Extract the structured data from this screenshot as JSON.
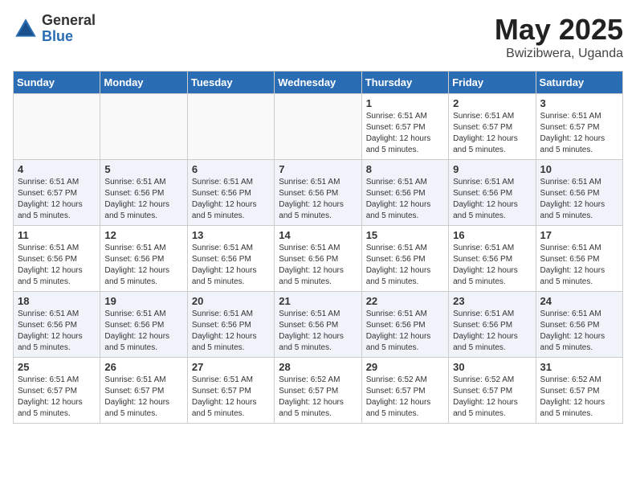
{
  "logo": {
    "general": "General",
    "blue": "Blue"
  },
  "header": {
    "month": "May 2025",
    "location": "Bwizibwera, Uganda"
  },
  "weekdays": [
    "Sunday",
    "Monday",
    "Tuesday",
    "Wednesday",
    "Thursday",
    "Friday",
    "Saturday"
  ],
  "weeks": [
    [
      {
        "day": null,
        "info": null
      },
      {
        "day": null,
        "info": null
      },
      {
        "day": null,
        "info": null
      },
      {
        "day": null,
        "info": null
      },
      {
        "day": "1",
        "info": "Sunrise: 6:51 AM\nSunset: 6:57 PM\nDaylight: 12 hours and 5 minutes."
      },
      {
        "day": "2",
        "info": "Sunrise: 6:51 AM\nSunset: 6:57 PM\nDaylight: 12 hours and 5 minutes."
      },
      {
        "day": "3",
        "info": "Sunrise: 6:51 AM\nSunset: 6:57 PM\nDaylight: 12 hours and 5 minutes."
      }
    ],
    [
      {
        "day": "4",
        "info": "Sunrise: 6:51 AM\nSunset: 6:57 PM\nDaylight: 12 hours and 5 minutes."
      },
      {
        "day": "5",
        "info": "Sunrise: 6:51 AM\nSunset: 6:56 PM\nDaylight: 12 hours and 5 minutes."
      },
      {
        "day": "6",
        "info": "Sunrise: 6:51 AM\nSunset: 6:56 PM\nDaylight: 12 hours and 5 minutes."
      },
      {
        "day": "7",
        "info": "Sunrise: 6:51 AM\nSunset: 6:56 PM\nDaylight: 12 hours and 5 minutes."
      },
      {
        "day": "8",
        "info": "Sunrise: 6:51 AM\nSunset: 6:56 PM\nDaylight: 12 hours and 5 minutes."
      },
      {
        "day": "9",
        "info": "Sunrise: 6:51 AM\nSunset: 6:56 PM\nDaylight: 12 hours and 5 minutes."
      },
      {
        "day": "10",
        "info": "Sunrise: 6:51 AM\nSunset: 6:56 PM\nDaylight: 12 hours and 5 minutes."
      }
    ],
    [
      {
        "day": "11",
        "info": "Sunrise: 6:51 AM\nSunset: 6:56 PM\nDaylight: 12 hours and 5 minutes."
      },
      {
        "day": "12",
        "info": "Sunrise: 6:51 AM\nSunset: 6:56 PM\nDaylight: 12 hours and 5 minutes."
      },
      {
        "day": "13",
        "info": "Sunrise: 6:51 AM\nSunset: 6:56 PM\nDaylight: 12 hours and 5 minutes."
      },
      {
        "day": "14",
        "info": "Sunrise: 6:51 AM\nSunset: 6:56 PM\nDaylight: 12 hours and 5 minutes."
      },
      {
        "day": "15",
        "info": "Sunrise: 6:51 AM\nSunset: 6:56 PM\nDaylight: 12 hours and 5 minutes."
      },
      {
        "day": "16",
        "info": "Sunrise: 6:51 AM\nSunset: 6:56 PM\nDaylight: 12 hours and 5 minutes."
      },
      {
        "day": "17",
        "info": "Sunrise: 6:51 AM\nSunset: 6:56 PM\nDaylight: 12 hours and 5 minutes."
      }
    ],
    [
      {
        "day": "18",
        "info": "Sunrise: 6:51 AM\nSunset: 6:56 PM\nDaylight: 12 hours and 5 minutes."
      },
      {
        "day": "19",
        "info": "Sunrise: 6:51 AM\nSunset: 6:56 PM\nDaylight: 12 hours and 5 minutes."
      },
      {
        "day": "20",
        "info": "Sunrise: 6:51 AM\nSunset: 6:56 PM\nDaylight: 12 hours and 5 minutes."
      },
      {
        "day": "21",
        "info": "Sunrise: 6:51 AM\nSunset: 6:56 PM\nDaylight: 12 hours and 5 minutes."
      },
      {
        "day": "22",
        "info": "Sunrise: 6:51 AM\nSunset: 6:56 PM\nDaylight: 12 hours and 5 minutes."
      },
      {
        "day": "23",
        "info": "Sunrise: 6:51 AM\nSunset: 6:56 PM\nDaylight: 12 hours and 5 minutes."
      },
      {
        "day": "24",
        "info": "Sunrise: 6:51 AM\nSunset: 6:56 PM\nDaylight: 12 hours and 5 minutes."
      }
    ],
    [
      {
        "day": "25",
        "info": "Sunrise: 6:51 AM\nSunset: 6:57 PM\nDaylight: 12 hours and 5 minutes."
      },
      {
        "day": "26",
        "info": "Sunrise: 6:51 AM\nSunset: 6:57 PM\nDaylight: 12 hours and 5 minutes."
      },
      {
        "day": "27",
        "info": "Sunrise: 6:51 AM\nSunset: 6:57 PM\nDaylight: 12 hours and 5 minutes."
      },
      {
        "day": "28",
        "info": "Sunrise: 6:52 AM\nSunset: 6:57 PM\nDaylight: 12 hours and 5 minutes."
      },
      {
        "day": "29",
        "info": "Sunrise: 6:52 AM\nSunset: 6:57 PM\nDaylight: 12 hours and 5 minutes."
      },
      {
        "day": "30",
        "info": "Sunrise: 6:52 AM\nSunset: 6:57 PM\nDaylight: 12 hours and 5 minutes."
      },
      {
        "day": "31",
        "info": "Sunrise: 6:52 AM\nSunset: 6:57 PM\nDaylight: 12 hours and 5 minutes."
      }
    ]
  ]
}
